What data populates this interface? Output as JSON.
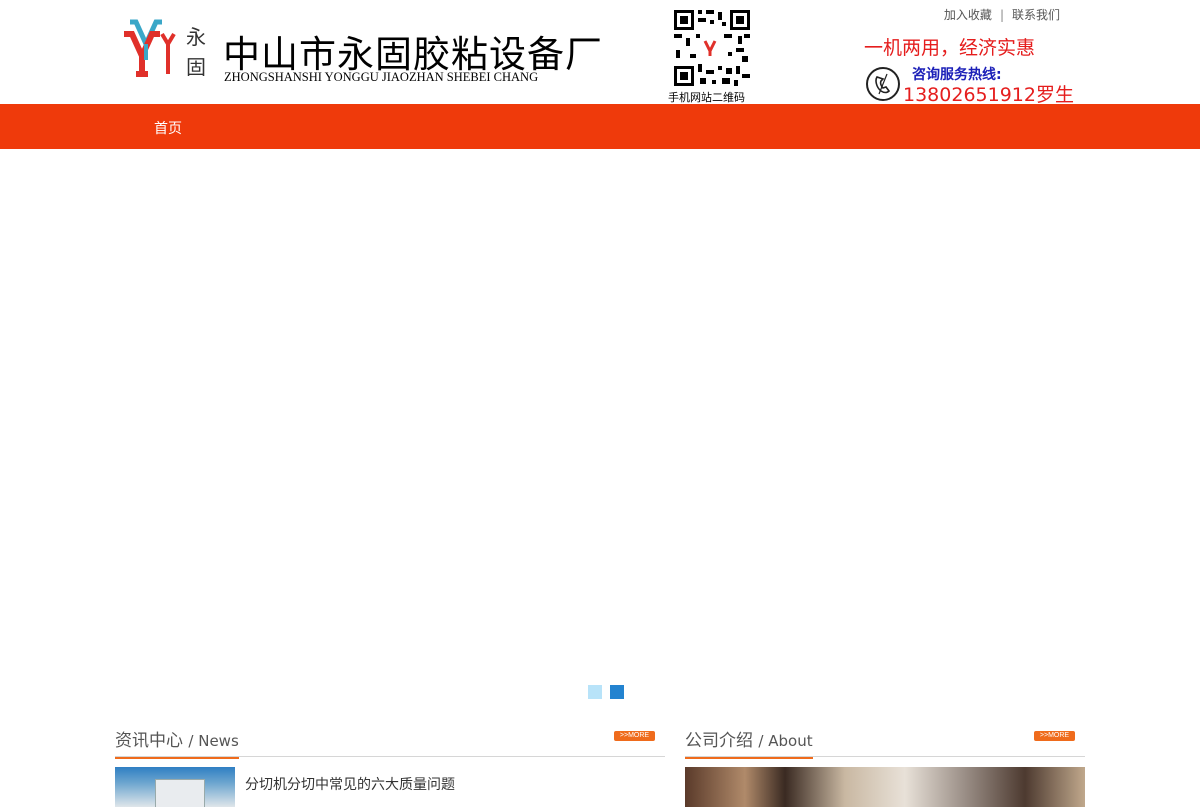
{
  "header": {
    "company_cn": "中山市永固胶粘设备厂",
    "company_en": "ZHONGSHANSHI YONGGU JIAOZHAN SHEBEI CHANG",
    "logo_chars": [
      "永",
      "固"
    ],
    "qr_caption": "手机网站二维码",
    "toplinks": {
      "bookmark": "加入收藏",
      "separator": "|",
      "contact": "联系我们"
    },
    "slogan": "一机两用，经济实惠",
    "hotline_label": "咨询服务热线:",
    "hotline_number": "13802651912罗生"
  },
  "nav": {
    "items": [
      {
        "label": "首页"
      }
    ]
  },
  "carousel": {
    "dot_count": 2,
    "active_index": 1
  },
  "news": {
    "title_cn": "资讯中心",
    "title_en": "/ News",
    "more_label": ">>MORE",
    "items": [
      {
        "title": "分切机分切中常见的六大质量问题"
      }
    ]
  },
  "about": {
    "title_cn": "公司介绍",
    "title_en": "/ About",
    "more_label": ">>MORE"
  },
  "colors": {
    "nav_bg": "#ef3a0b",
    "accent_red": "#e51d1d",
    "hotline_blue": "#1c20b8",
    "more_orange": "#ef6b1c"
  }
}
